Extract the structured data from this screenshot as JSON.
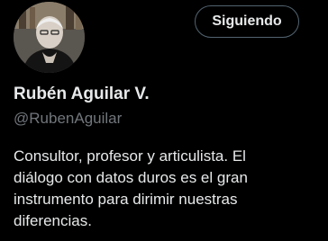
{
  "profile": {
    "display_name": "Rubén Aguilar V.",
    "handle": "@RubenAguilar",
    "follow_button_label": "Siguiendo",
    "bio_lines": [
      "Consultor, profesor y articulista. El",
      "diálogo con datos duros es el gran",
      "instrumento para dirimir nuestras",
      "diferencias."
    ]
  },
  "colors": {
    "background": "#000000",
    "primary_text": "#e7e9ea",
    "secondary_text": "#71767b",
    "button_border": "#536471"
  }
}
